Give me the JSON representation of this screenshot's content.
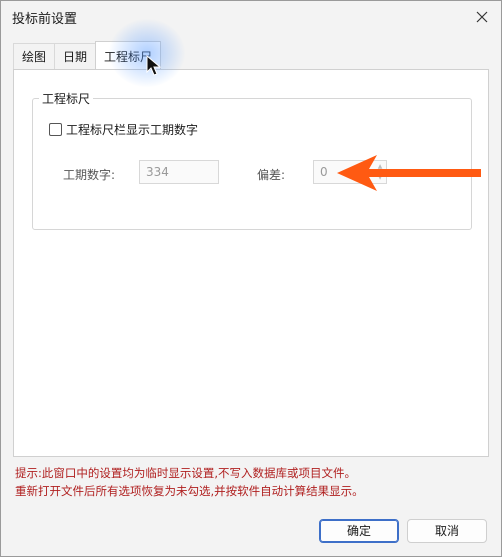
{
  "window": {
    "title": "投标前设置"
  },
  "tabs": [
    {
      "label": "绘图"
    },
    {
      "label": "日期"
    },
    {
      "label": "工程标尺"
    }
  ],
  "group": {
    "title": "工程标尺",
    "checkbox_label": "工程标尺栏显示工期数字",
    "checked": false,
    "duration_label": "工期数字:",
    "duration_value": "334",
    "offset_label": "偏差:",
    "offset_value": "0"
  },
  "hint": {
    "line1": "提示:此窗口中的设置均为临时显示设置,不写入数据库或项目文件。",
    "line2": "重新打开文件后所有选项恢复为未勾选,并按软件自动计算结果显示。"
  },
  "buttons": {
    "ok": "确定",
    "cancel": "取消"
  },
  "colors": {
    "annotation_arrow": "#ff5a12",
    "hint_text": "#b02020",
    "accent": "#3d6fc8"
  }
}
